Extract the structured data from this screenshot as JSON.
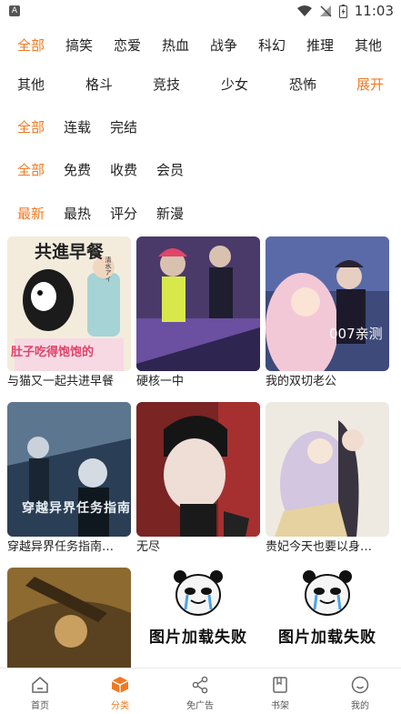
{
  "status_bar": {
    "time": "11:03",
    "app_badge": "A"
  },
  "filters": {
    "genre_row1": [
      "全部",
      "搞笑",
      "恋爱",
      "热血",
      "战争",
      "科幻",
      "推理",
      "其他"
    ],
    "genre_row2": [
      "其他",
      "格斗",
      "竞技",
      "少女",
      "恐怖",
      "展开"
    ],
    "status": [
      "全部",
      "连载",
      "完结"
    ],
    "price": [
      "全部",
      "免费",
      "收费",
      "会员"
    ],
    "sort": [
      "最新",
      "最热",
      "评分",
      "新漫"
    ]
  },
  "comics": [
    {
      "title": "与猫又一起共进早餐",
      "cover_text_top": "共進早餐",
      "cover_text_bottom": "肚子吃得饱饱的",
      "cover_author": "清水アイ"
    },
    {
      "title": "硬核一中"
    },
    {
      "title": "我的双切老公",
      "badge": "007亲测"
    },
    {
      "title": "穿越异界任务指南…",
      "cover_text": "穿越异界任务指南"
    },
    {
      "title": "无尽"
    },
    {
      "title": "贵妃今天也要以身…"
    },
    {
      "title": ""
    },
    {
      "title": "",
      "fail_text": "图片加载失败"
    },
    {
      "title": "",
      "fail_text": "图片加载失败"
    }
  ],
  "tabbar": {
    "home": "首页",
    "category": "分类",
    "no_ads": "免广告",
    "bookshelf": "书架",
    "mine": "我的"
  },
  "colors": {
    "accent": "#f07a24"
  }
}
